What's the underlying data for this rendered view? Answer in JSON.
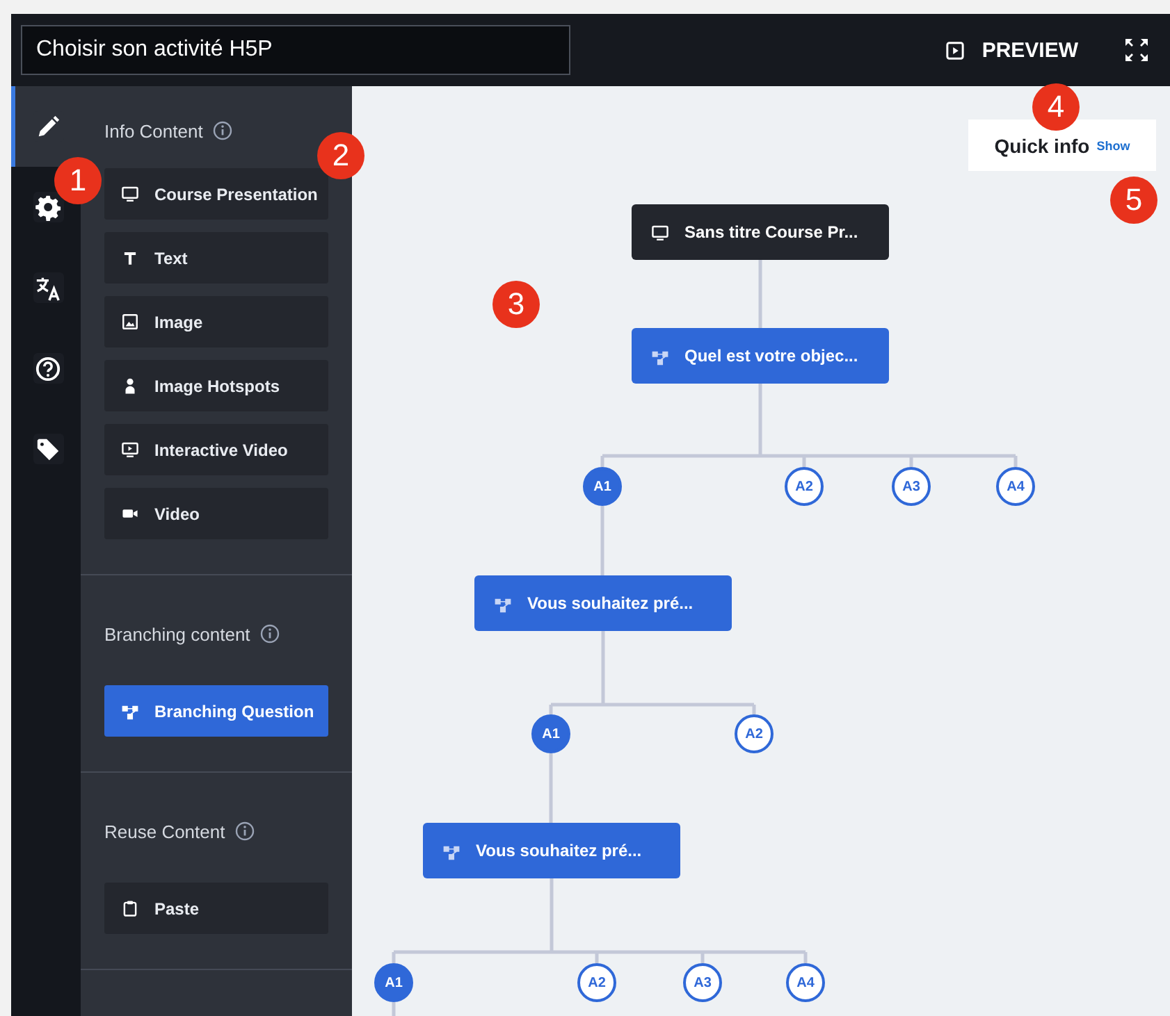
{
  "header": {
    "title": "Choisir son activité H5P",
    "preview_label": "PREVIEW"
  },
  "rail_tabs": [
    {
      "selected": true
    },
    {
      "selected": false
    },
    {
      "selected": false
    },
    {
      "selected": false
    },
    {
      "selected": false
    }
  ],
  "sections": [
    {
      "title": "Info Content",
      "items": [
        {
          "label": "Course Presentation",
          "highlighted": false
        },
        {
          "label": "Text",
          "highlighted": false
        },
        {
          "label": "Image",
          "highlighted": false
        },
        {
          "label": "Image Hotspots",
          "highlighted": false
        },
        {
          "label": "Interactive Video",
          "highlighted": false
        },
        {
          "label": "Video",
          "highlighted": false
        }
      ]
    },
    {
      "title": "Branching content",
      "items": [
        {
          "label": "Branching Question",
          "highlighted": true
        }
      ]
    },
    {
      "title": "Reuse Content",
      "items": [
        {
          "label": "Paste",
          "highlighted": false
        }
      ]
    }
  ],
  "quick_info": {
    "title": "Quick info",
    "link": "Show"
  },
  "tree": {
    "kind": "content",
    "label": "Sans titre Course Pr...",
    "children": [
      {
        "kind": "question",
        "label": "Quel est votre objec...",
        "answers": [
          {
            "label": "A1",
            "filled": true,
            "children": [
              {
                "kind": "question",
                "label": "Vous souhaitez pré...",
                "answers": [
                  {
                    "label": "A1",
                    "filled": true,
                    "children": [
                      {
                        "kind": "question",
                        "label": "Vous souhaitez pré...",
                        "answers": [
                          {
                            "label": "A1",
                            "filled": true
                          },
                          {
                            "label": "A2",
                            "filled": false
                          },
                          {
                            "label": "A3",
                            "filled": false
                          },
                          {
                            "label": "A4",
                            "filled": false
                          }
                        ]
                      }
                    ]
                  },
                  {
                    "label": "A2",
                    "filled": false
                  }
                ]
              }
            ]
          },
          {
            "label": "A2",
            "filled": false
          },
          {
            "label": "A3",
            "filled": false
          },
          {
            "label": "A4",
            "filled": false
          }
        ]
      }
    ]
  },
  "annotations": [
    {
      "label": "1"
    },
    {
      "label": "2"
    },
    {
      "label": "3"
    },
    {
      "label": "4"
    },
    {
      "label": "5"
    }
  ]
}
